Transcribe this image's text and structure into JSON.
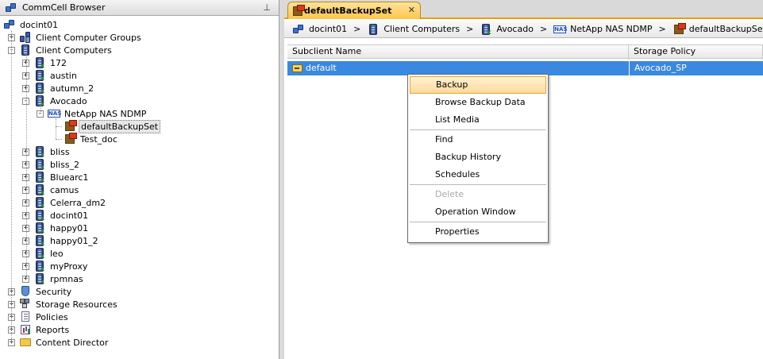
{
  "left_pane": {
    "title": "CommCell Browser",
    "pin_glyph": "⊥",
    "tree": [
      {
        "label": "docint01",
        "icon": "commcell-icon",
        "level": 0,
        "expander": ""
      },
      {
        "label": "Client Computer Groups",
        "icon": "client-group-icon",
        "level": 1,
        "expander": "+"
      },
      {
        "label": "Client Computers",
        "icon": "client-computers-icon",
        "level": 1,
        "expander": "−"
      },
      {
        "label": "172",
        "icon": "client-server-icon",
        "level": 2,
        "expander": "+"
      },
      {
        "label": "austin",
        "icon": "client-server-icon",
        "level": 2,
        "expander": "+"
      },
      {
        "label": "autumn_2",
        "icon": "client-server-icon",
        "level": 2,
        "expander": "+"
      },
      {
        "label": "Avocado",
        "icon": "client-server-icon",
        "level": 2,
        "expander": "−"
      },
      {
        "label": "NetApp NAS NDMP",
        "icon": "nas-icon",
        "level": 3,
        "expander": "−"
      },
      {
        "label": "defaultBackupSet",
        "icon": "backupset-icon",
        "level": 4,
        "expander": "",
        "selected": true
      },
      {
        "label": "Test_doc",
        "icon": "backupset-icon",
        "level": 4,
        "expander": ""
      },
      {
        "label": "bliss",
        "icon": "client-server-icon",
        "level": 2,
        "expander": "+"
      },
      {
        "label": "bliss_2",
        "icon": "client-server-icon",
        "level": 2,
        "expander": "+"
      },
      {
        "label": "Bluearc1",
        "icon": "client-server-icon",
        "level": 2,
        "expander": "+"
      },
      {
        "label": "camus",
        "icon": "client-server-icon",
        "level": 2,
        "expander": "+"
      },
      {
        "label": "Celerra_dm2",
        "icon": "client-server-icon",
        "level": 2,
        "expander": "+"
      },
      {
        "label": "docint01",
        "icon": "client-server-icon",
        "level": 2,
        "expander": "+"
      },
      {
        "label": "happy01",
        "icon": "client-server-icon",
        "level": 2,
        "expander": "+"
      },
      {
        "label": "happy01_2",
        "icon": "client-server-icon",
        "level": 2,
        "expander": "+"
      },
      {
        "label": "leo",
        "icon": "client-server-icon",
        "level": 2,
        "expander": "+"
      },
      {
        "label": "myProxy",
        "icon": "client-server-icon",
        "level": 2,
        "expander": "+"
      },
      {
        "label": "rpmnas",
        "icon": "client-server-icon",
        "level": 2,
        "expander": "+"
      },
      {
        "label": "Security",
        "icon": "security-icon",
        "level": 1,
        "expander": "+"
      },
      {
        "label": "Storage Resources",
        "icon": "storage-icon",
        "level": 1,
        "expander": "+"
      },
      {
        "label": "Policies",
        "icon": "policies-icon",
        "level": 1,
        "expander": "+"
      },
      {
        "label": "Reports",
        "icon": "reports-icon",
        "level": 1,
        "expander": "+"
      },
      {
        "label": "Content Director",
        "icon": "folder-icon",
        "level": 1,
        "expander": "+"
      }
    ]
  },
  "tab": {
    "label": "defaultBackupSet",
    "close_glyph": "✕"
  },
  "breadcrumb": {
    "items": [
      {
        "label": "docint01",
        "icon": "commcell-icon"
      },
      {
        "label": "Client Computers",
        "icon": "client-computers-icon"
      },
      {
        "label": "Avocado",
        "icon": "client-server-icon"
      },
      {
        "label": "NetApp NAS NDMP",
        "icon": "nas-icon"
      },
      {
        "label": "defaultBackupSet",
        "icon": "backupset-icon"
      }
    ],
    "separator": ">"
  },
  "table": {
    "columns": [
      "Subclient Name",
      "Storage Policy"
    ],
    "rows": [
      {
        "subclient": "default",
        "storage_policy": "Avocado_SP",
        "selected": true
      }
    ]
  },
  "context_menu": {
    "items": [
      {
        "label": "Backup",
        "state": "highlighted"
      },
      {
        "label": "Browse Backup Data",
        "state": "enabled"
      },
      {
        "label": "List Media",
        "state": "enabled"
      },
      {
        "separator": true
      },
      {
        "label": "Find",
        "state": "enabled"
      },
      {
        "label": "Backup History",
        "state": "enabled"
      },
      {
        "label": "Schedules",
        "state": "enabled"
      },
      {
        "separator": true
      },
      {
        "label": "Delete",
        "state": "disabled"
      },
      {
        "label": "Operation Window",
        "state": "enabled"
      },
      {
        "separator": true
      },
      {
        "label": "Properties",
        "state": "enabled"
      }
    ]
  },
  "colors": {
    "selection_blue": "#3a88e0",
    "tab_orange": "#ffc64a",
    "menu_highlight": "#ffd99a"
  }
}
